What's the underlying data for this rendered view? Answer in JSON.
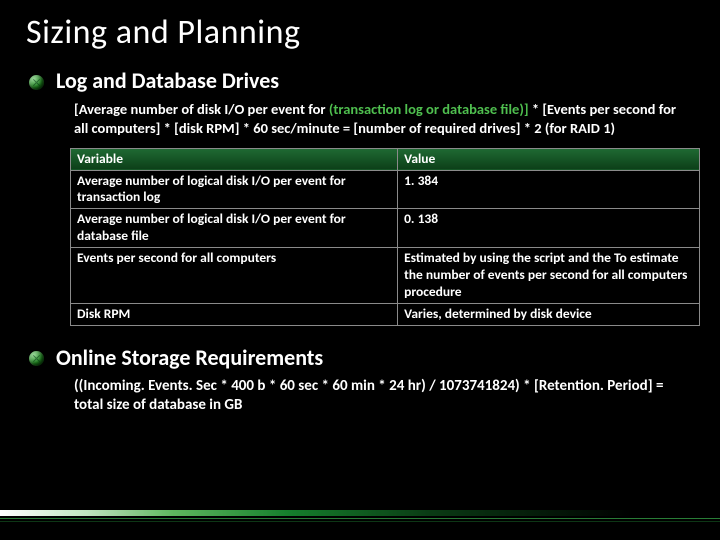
{
  "title": "Sizing and Planning",
  "section1": {
    "heading": "Log and Database Drives",
    "formula_a": "[Average number of disk I/O per event for ",
    "formula_hl": "(transaction log or database file)]",
    "formula_b": " * [Events per second for all computers] * [disk RPM] * 60 sec/minute = [number of required drives] * 2 (for RAID 1)"
  },
  "table": {
    "header_var": "Variable",
    "header_val": "Value",
    "rows": [
      {
        "var": "Average number of logical disk I/O per event for transaction log",
        "val": "1. 384"
      },
      {
        "var": "Average number of logical disk I/O per event for database file",
        "val": "0. 138"
      },
      {
        "var": "Events per second for all computers",
        "val": "Estimated by using the script and the To estimate the number of events per second for all computers procedure"
      },
      {
        "var": "Disk RPM",
        "val": "Varies, determined by disk device"
      }
    ]
  },
  "section2": {
    "heading": "Online Storage Requirements",
    "formula": "((Incoming. Events. Sec * 400 b * 60 sec * 60 min * 24 hr) / 1073741824) * [Retention. Period] = total size of database in GB"
  }
}
